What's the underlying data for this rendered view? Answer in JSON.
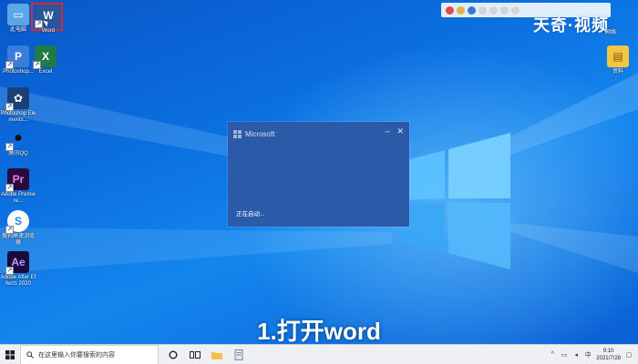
{
  "desktop": {
    "icons": [
      {
        "label": "此电脑"
      },
      {
        "label": "Word"
      },
      {
        "label": "Photoshop..."
      },
      {
        "label": "Excel"
      },
      {
        "label": "Photoshop Elements..."
      },
      {
        "label": "腾讯QQ"
      },
      {
        "label": "Adobe Premiere..."
      },
      {
        "label": "搜狗高速浏览器"
      },
      {
        "label": "Adobe After Effects 2020"
      },
      {
        "label": "资料"
      }
    ],
    "corner_label": "网络"
  },
  "watermark": {
    "brand": "天奇·视频"
  },
  "splash": {
    "logo_text": "Microsoft",
    "minimize": "–",
    "close": "✕",
    "status": "正在启动..."
  },
  "caption": "1.打开word",
  "taskbar": {
    "search_placeholder": "在这里输入你要搜索的内容",
    "time": "9:10",
    "date": "2021/7/28"
  },
  "colors": {
    "desktop_blue": "#0b6fe0",
    "splash_bg": "#2a5aa8",
    "highlight_red": "#e02828"
  }
}
